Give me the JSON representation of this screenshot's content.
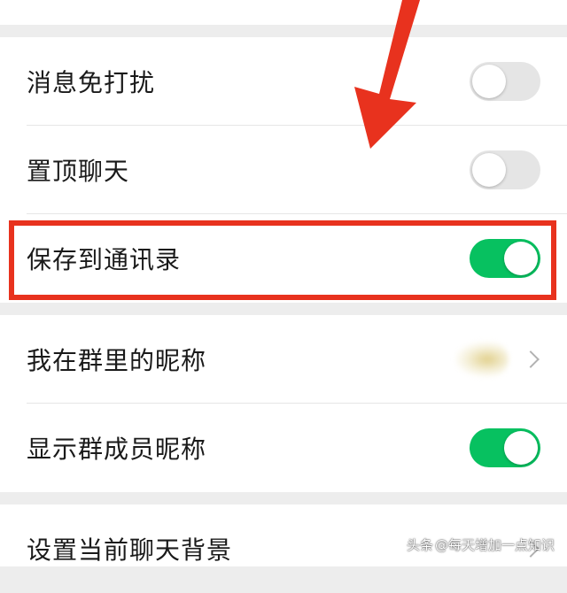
{
  "settings": {
    "rows": [
      {
        "label": "消息免打扰",
        "toggle": "off"
      },
      {
        "label": "置顶聊天",
        "toggle": "off"
      },
      {
        "label": "保存到通讯录",
        "toggle": "on"
      },
      {
        "label": "我在群里的昵称"
      },
      {
        "label": "显示群成员昵称",
        "toggle": "on"
      },
      {
        "label": "设置当前聊天背景"
      }
    ]
  },
  "colors": {
    "toggle_on": "#07c160",
    "toggle_off": "#e5e5e5",
    "highlight": "#e8321e",
    "arrow": "#e8321e"
  },
  "watermark": {
    "brand": "头条",
    "handle": "@每天增加一点知识"
  }
}
